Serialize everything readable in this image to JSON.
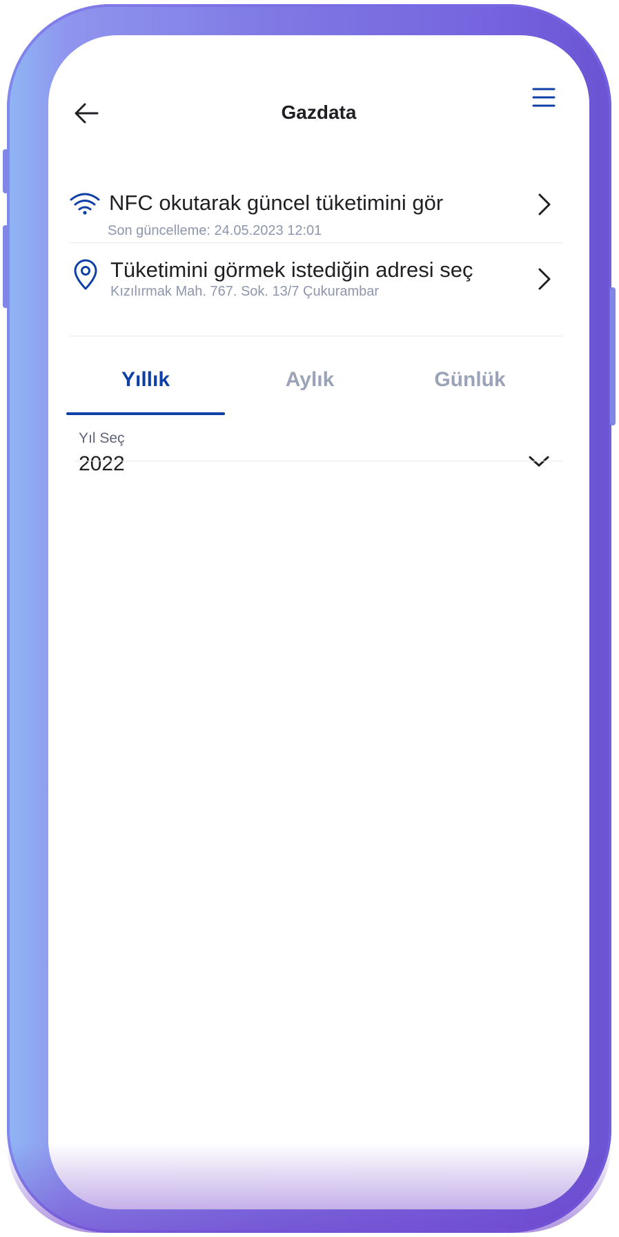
{
  "header": {
    "title": "Gazdata"
  },
  "nfc_row": {
    "title": "NFC okutarak güncel tüketimini gör",
    "subtitle": "Son güncelleme: 24.05.2023 12:01",
    "icon": "wifi-icon"
  },
  "address_row": {
    "title": "Tüketimini görmek istediğin adresi seç",
    "subtitle": "Kızılırmak Mah. 767. Sok. 13/7 Çukurambar",
    "icon": "location-pin-icon"
  },
  "tabs": [
    {
      "label": "Yıllık",
      "active": true
    },
    {
      "label": "Aylık",
      "active": false
    },
    {
      "label": "Günlük",
      "active": false
    }
  ],
  "year_select": {
    "label": "Yıl Seç",
    "value": "2022"
  },
  "colors": {
    "accent": "#0d3fa6",
    "inactive_tab": "#9aa3b8",
    "subtitle": "#8d96ad",
    "frame": "#7f78e4"
  }
}
